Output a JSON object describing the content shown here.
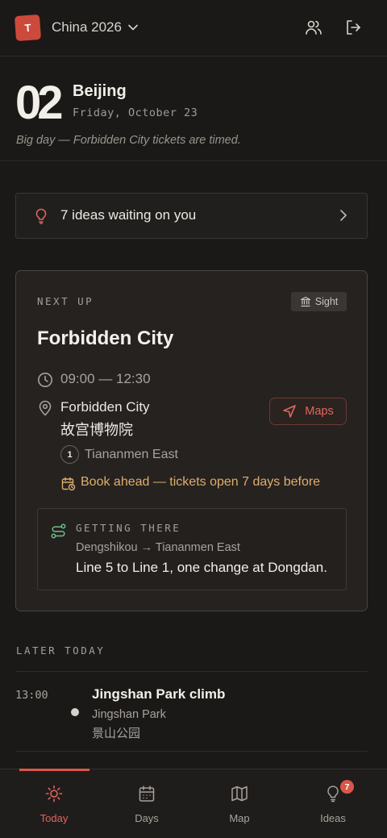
{
  "header": {
    "avatar_letter": "T",
    "trip_name": "China 2026",
    "icons": [
      "users-icon",
      "logout-icon"
    ]
  },
  "day": {
    "number": "02",
    "city": "Beijing",
    "date": "Friday, October 23",
    "note": "Big day — Forbidden City tickets are timed."
  },
  "ideas_banner": {
    "text": "7 ideas waiting on you"
  },
  "next_up": {
    "label": "NEXT UP",
    "tag": "Sight",
    "title": "Forbidden City",
    "time": "09:00 — 12:30",
    "place_name": "Forbidden City",
    "place_name_cn": "故宫博物院",
    "maps_label": "Maps",
    "metro_line": "1",
    "station": "Tiananmen East",
    "booking_note": "Book ahead — tickets open 7 days before",
    "getting_there": {
      "label": "GETTING THERE",
      "route": "Dengshikou → Tiananmen East",
      "description": "Line 5 to Line 1, one change at Dongdan."
    }
  },
  "later_today": {
    "label": "LATER TODAY",
    "items": [
      {
        "time": "13:00",
        "title": "Jingshan Park climb",
        "place": "Jingshan Park",
        "place_cn": "景山公园"
      }
    ]
  },
  "nav": {
    "tabs": [
      {
        "label": "Today",
        "icon": "sun-icon",
        "active": true
      },
      {
        "label": "Days",
        "icon": "calendar-icon",
        "active": false
      },
      {
        "label": "Map",
        "icon": "map-icon",
        "active": false
      },
      {
        "label": "Ideas",
        "icon": "lightbulb-icon",
        "active": false,
        "badge": "7"
      }
    ]
  },
  "colors": {
    "background": "#1b1918",
    "accent": "#d9574a",
    "warning": "#dfae6c",
    "route": "#6cc08a"
  }
}
